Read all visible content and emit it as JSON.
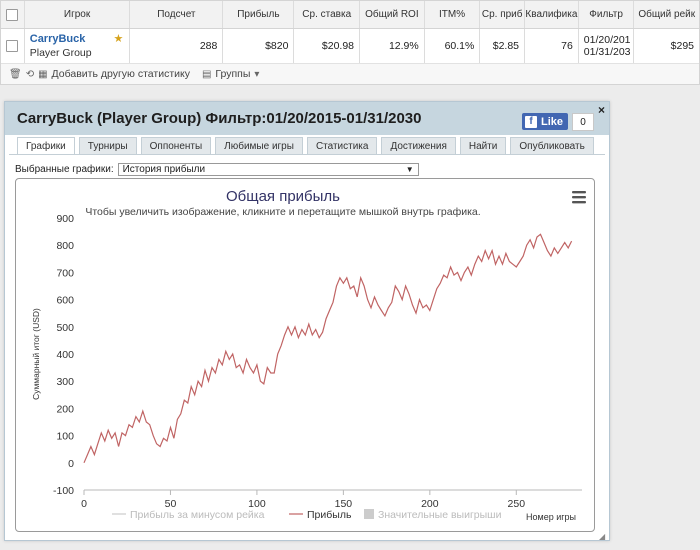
{
  "table": {
    "headers": [
      "Игрок",
      "Подсчет",
      "Прибыль",
      "Ср. ставка",
      "Общий ROI",
      "ITM%",
      "Ср. приб",
      "Квалифика",
      "Фильтр",
      "Общий рейк"
    ],
    "row": {
      "player": "CarryBuck",
      "group": "Player Group",
      "count": "288",
      "profit": "$820",
      "avg_stake": "$20.98",
      "roi": "12.9%",
      "itm": "60.1%",
      "avg_profit": "$2.85",
      "qualifications": "76",
      "filter_from": "01/20/201",
      "filter_to": "01/31/203",
      "rake": "$295"
    },
    "toolbar": {
      "add_stats": "Добавить другую статистику",
      "groups": "Группы"
    }
  },
  "dialog": {
    "title": "CarryBuck (Player Group) Фильтр:01/20/2015-01/31/2030",
    "like_label": "Like",
    "like_count": "0",
    "close": "×",
    "tabs": [
      "Графики",
      "Турниры",
      "Оппоненты",
      "Любимые игры",
      "Статистика",
      "Достижения",
      "Найти",
      "Опубликовать"
    ],
    "active_tab": 0,
    "select_label": "Выбранные графики:",
    "select_value": "История прибыли"
  },
  "icons": {
    "trash": "trash-icon",
    "link": "link-icon",
    "chart_add": "chart-add-icon",
    "groups": "groups-icon",
    "trophy": "trophy-icon",
    "menu": "menu-icon",
    "facebook": "facebook-icon"
  },
  "colors": {
    "series_profit": "#c06464",
    "series_rake": "#cccccc",
    "series_big_wins": "#cccccc",
    "title": "#333366",
    "link": "#2a64a8",
    "header_bg": "#c6d6df"
  },
  "chart_data": {
    "type": "line",
    "title": "Общая прибыль",
    "subtitle": "Чтобы увеличить изображение, кликните и перетащите мышкой внутрь графика.",
    "xlabel": "Номер игры",
    "ylabel": "Суммарный итог (USD)",
    "xlim": [
      0,
      288
    ],
    "ylim": [
      -100,
      900
    ],
    "x_ticks": [
      0,
      50,
      100,
      150,
      200,
      250
    ],
    "y_ticks": [
      -100,
      0,
      100,
      200,
      300,
      400,
      500,
      600,
      700,
      800,
      900
    ],
    "legend": [
      "Прибыль за минусом рейка",
      "Прибыль",
      "Значительные выигрыши"
    ],
    "grid": false,
    "legend_position": "bottom",
    "series": [
      {
        "name": "Прибыль",
        "points": [
          [
            0,
            0
          ],
          [
            2,
            30
          ],
          [
            4,
            60
          ],
          [
            6,
            30
          ],
          [
            8,
            70
          ],
          [
            10,
            110
          ],
          [
            12,
            80
          ],
          [
            14,
            120
          ],
          [
            16,
            90
          ],
          [
            18,
            110
          ],
          [
            20,
            60
          ],
          [
            22,
            110
          ],
          [
            24,
            100
          ],
          [
            26,
            140
          ],
          [
            28,
            130
          ],
          [
            30,
            170
          ],
          [
            32,
            150
          ],
          [
            34,
            190
          ],
          [
            36,
            150
          ],
          [
            38,
            140
          ],
          [
            40,
            100
          ],
          [
            42,
            70
          ],
          [
            44,
            60
          ],
          [
            46,
            90
          ],
          [
            48,
            80
          ],
          [
            50,
            130
          ],
          [
            52,
            90
          ],
          [
            54,
            160
          ],
          [
            56,
            180
          ],
          [
            58,
            230
          ],
          [
            60,
            220
          ],
          [
            62,
            280
          ],
          [
            64,
            250
          ],
          [
            66,
            300
          ],
          [
            68,
            280
          ],
          [
            70,
            340
          ],
          [
            72,
            300
          ],
          [
            74,
            350
          ],
          [
            76,
            330
          ],
          [
            78,
            380
          ],
          [
            80,
            360
          ],
          [
            82,
            410
          ],
          [
            84,
            380
          ],
          [
            86,
            400
          ],
          [
            88,
            350
          ],
          [
            90,
            360
          ],
          [
            92,
            330
          ],
          [
            94,
            380
          ],
          [
            96,
            350
          ],
          [
            98,
            330
          ],
          [
            100,
            360
          ],
          [
            102,
            300
          ],
          [
            104,
            290
          ],
          [
            106,
            350
          ],
          [
            108,
            330
          ],
          [
            110,
            330
          ],
          [
            112,
            400
          ],
          [
            114,
            430
          ],
          [
            116,
            470
          ],
          [
            118,
            500
          ],
          [
            120,
            470
          ],
          [
            122,
            500
          ],
          [
            124,
            460
          ],
          [
            126,
            490
          ],
          [
            128,
            470
          ],
          [
            130,
            510
          ],
          [
            132,
            470
          ],
          [
            134,
            490
          ],
          [
            136,
            460
          ],
          [
            138,
            480
          ],
          [
            140,
            530
          ],
          [
            142,
            560
          ],
          [
            144,
            590
          ],
          [
            146,
            650
          ],
          [
            148,
            680
          ],
          [
            150,
            660
          ],
          [
            152,
            680
          ],
          [
            154,
            640
          ],
          [
            156,
            650
          ],
          [
            158,
            610
          ],
          [
            160,
            680
          ],
          [
            162,
            650
          ],
          [
            164,
            600
          ],
          [
            166,
            570
          ],
          [
            168,
            610
          ],
          [
            170,
            580
          ],
          [
            172,
            560
          ],
          [
            174,
            540
          ],
          [
            176,
            570
          ],
          [
            178,
            590
          ],
          [
            180,
            650
          ],
          [
            182,
            630
          ],
          [
            184,
            600
          ],
          [
            186,
            650
          ],
          [
            188,
            620
          ],
          [
            190,
            580
          ],
          [
            192,
            550
          ],
          [
            194,
            600
          ],
          [
            196,
            570
          ],
          [
            198,
            580
          ],
          [
            200,
            560
          ],
          [
            202,
            600
          ],
          [
            204,
            640
          ],
          [
            206,
            660
          ],
          [
            208,
            690
          ],
          [
            210,
            680
          ],
          [
            212,
            720
          ],
          [
            214,
            690
          ],
          [
            216,
            700
          ],
          [
            218,
            670
          ],
          [
            220,
            700
          ],
          [
            222,
            720
          ],
          [
            224,
            690
          ],
          [
            226,
            730
          ],
          [
            228,
            760
          ],
          [
            230,
            740
          ],
          [
            232,
            780
          ],
          [
            234,
            750
          ],
          [
            236,
            780
          ],
          [
            238,
            730
          ],
          [
            240,
            760
          ],
          [
            242,
            730
          ],
          [
            244,
            770
          ],
          [
            246,
            740
          ],
          [
            248,
            730
          ],
          [
            250,
            720
          ],
          [
            252,
            740
          ],
          [
            254,
            760
          ],
          [
            256,
            800
          ],
          [
            258,
            820
          ],
          [
            260,
            790
          ],
          [
            262,
            830
          ],
          [
            264,
            840
          ],
          [
            266,
            810
          ],
          [
            268,
            780
          ],
          [
            270,
            760
          ],
          [
            272,
            790
          ],
          [
            274,
            770
          ],
          [
            276,
            790
          ],
          [
            278,
            810
          ],
          [
            280,
            790
          ],
          [
            282,
            815
          ]
        ]
      }
    ]
  }
}
